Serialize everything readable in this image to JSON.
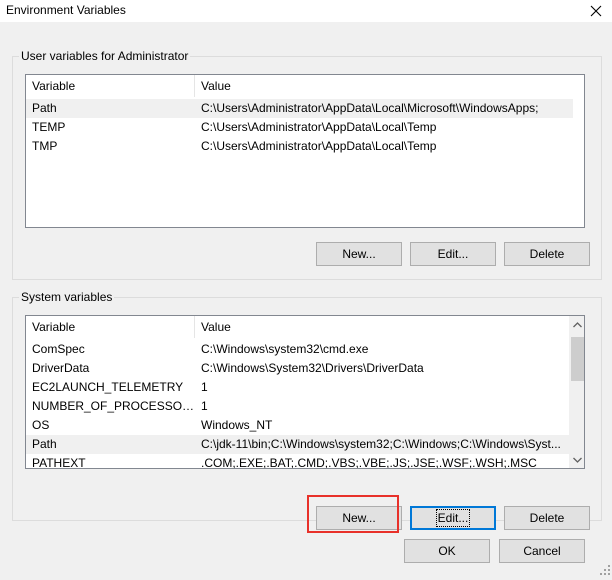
{
  "window": {
    "title": "Environment Variables",
    "close_icon": "close-icon"
  },
  "user_section": {
    "label": "User variables for Administrator",
    "columns": [
      "Variable",
      "Value"
    ],
    "rows": [
      {
        "variable": "Path",
        "value": "C:\\Users\\Administrator\\AppData\\Local\\Microsoft\\WindowsApps;"
      },
      {
        "variable": "TEMP",
        "value": "C:\\Users\\Administrator\\AppData\\Local\\Temp"
      },
      {
        "variable": "TMP",
        "value": "C:\\Users\\Administrator\\AppData\\Local\\Temp"
      }
    ],
    "buttons": {
      "new": "New...",
      "edit": "Edit...",
      "delete": "Delete"
    }
  },
  "system_section": {
    "label": "System variables",
    "columns": [
      "Variable",
      "Value"
    ],
    "rows": [
      {
        "variable": "ComSpec",
        "value": "C:\\Windows\\system32\\cmd.exe"
      },
      {
        "variable": "DriverData",
        "value": "C:\\Windows\\System32\\Drivers\\DriverData"
      },
      {
        "variable": "EC2LAUNCH_TELEMETRY",
        "value": "1"
      },
      {
        "variable": "NUMBER_OF_PROCESSORS",
        "value": "1"
      },
      {
        "variable": "OS",
        "value": "Windows_NT"
      },
      {
        "variable": "Path",
        "value": "C:\\jdk-11\\bin;C:\\Windows\\system32;C:\\Windows;C:\\Windows\\Syst..."
      },
      {
        "variable": "PATHEXT",
        "value": ".COM;.EXE;.BAT;.CMD;.VBS;.VBE;.JS;.JSE;.WSF;.WSH;.MSC"
      }
    ],
    "buttons": {
      "new": "New...",
      "edit": "Edit...",
      "delete": "Delete"
    }
  },
  "dialog_buttons": {
    "ok": "OK",
    "cancel": "Cancel"
  },
  "colors": {
    "highlight": "#e8312a",
    "focus_border": "#0078d7",
    "selected_row": "#f0f0f0"
  }
}
